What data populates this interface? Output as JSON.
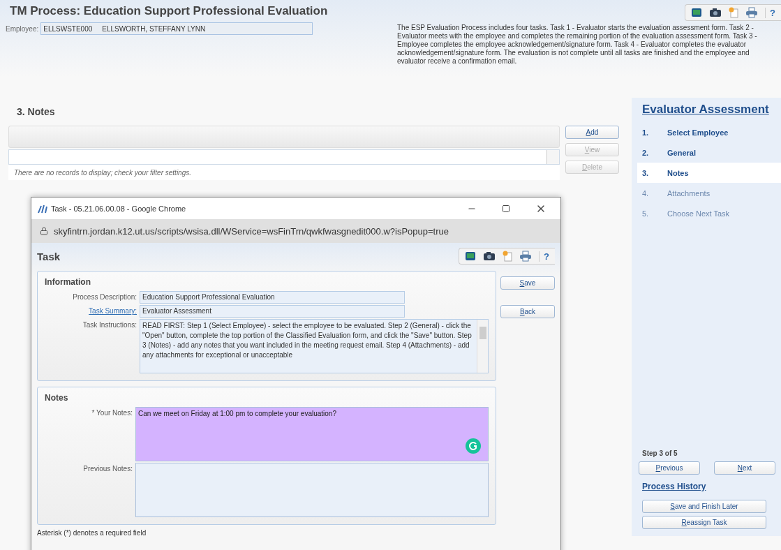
{
  "header": {
    "title": "TM Process: Education Support Professional Evaluation",
    "employee_label": "Employee:",
    "employee_id": "ELLSWSTE000",
    "employee_name": "ELLSWORTH, STEFFANY LYNN",
    "description": "The ESP Evaluation Process includes four tasks. Task 1 - Evaluator starts the evaluation assessment form. Task 2 - Evaluator meets with the employee and completes the remaining portion of the evaluation assessment form. Task 3 - Employee completes the employee acknowledgement/signature form. Task 4 - Evaluator completes the evaluator acknowledgement/signature form. The evaluation is not complete until all tasks are finished and the employee and evaluator receive a confirmation email.",
    "help": "?"
  },
  "section_title": "3. Notes",
  "grid": {
    "empty_message": "There are no records to display; check your filter settings."
  },
  "grid_buttons": [
    {
      "label": "Add",
      "disabled": false
    },
    {
      "label": "View",
      "disabled": true
    },
    {
      "label": "Delete",
      "disabled": true
    }
  ],
  "sidebar": {
    "title": "Evaluator Assessment",
    "steps": [
      {
        "number": "1.",
        "label": "Select Employee",
        "enabled": true,
        "selected": false
      },
      {
        "number": "2.",
        "label": "General",
        "enabled": true,
        "selected": false
      },
      {
        "number": "3.",
        "label": "Notes",
        "enabled": true,
        "selected": true
      },
      {
        "number": "4.",
        "label": "Attachments",
        "enabled": false,
        "selected": false
      },
      {
        "number": "5.",
        "label": "Choose Next Task",
        "enabled": false,
        "selected": false
      }
    ],
    "step_status": "Step 3 of 5",
    "nav_buttons": [
      "Previous",
      "Next"
    ],
    "history_link": "Process History",
    "actions": [
      "Save and Finish Later",
      "Reassign Task"
    ]
  },
  "popup": {
    "window_title": "Task - 05.21.06.00.08 - Google Chrome",
    "url": "skyfintrn.jordan.k12.ut.us/scripts/wsisa.dll/WService=wsFinTrn/qwkfwasgnedit000.w?isPopup=true",
    "title": "Task",
    "help": "?",
    "information": {
      "heading": "Information",
      "fields": [
        {
          "label": "Process Description:",
          "value": "Education Support Professional Evaluation",
          "link": false
        },
        {
          "label": "Task Summary:",
          "value": "Evaluator Assessment",
          "link": true
        }
      ],
      "instructions_label": "Task Instructions:",
      "instructions": "READ FIRST: Step 1 (Select Employee) - select the employee to be evaluated. Step 2 (General) - click the \"Open\" button, complete the top portion of the Classified Evaluation form, and click the \"Save\" button.  Step 3 (Notes) - add any notes that you want included in the meeting request email.  Step 4 (Attachments) - add any attachments for exceptional or unacceptable"
    },
    "buttons": [
      "Save",
      "Back"
    ],
    "notes": {
      "heading": "Notes",
      "your_notes_label": "* Your Notes:",
      "your_notes_value": "Can we meet on Friday at 1:00 pm to complete your evaluation?",
      "previous_notes_label": "Previous Notes:"
    },
    "footnote": "Asterisk (*) denotes a required field"
  }
}
